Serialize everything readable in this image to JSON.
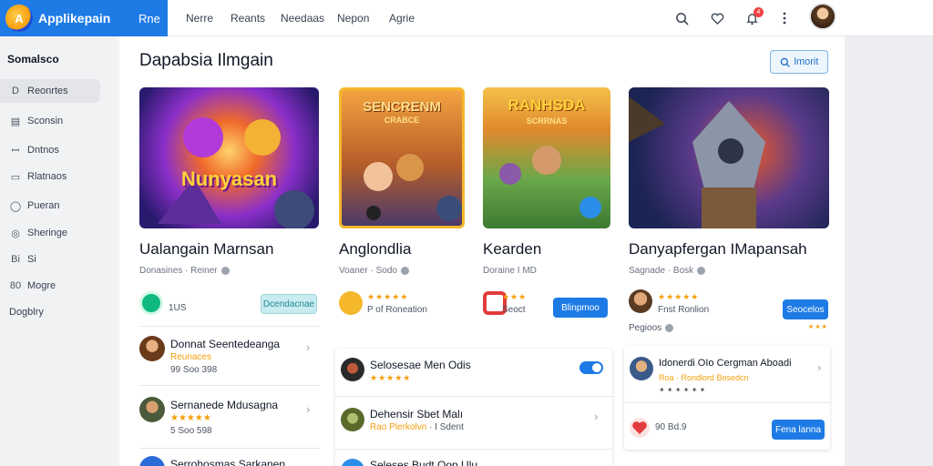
{
  "topbar": {
    "brand_name": "Applikepain",
    "brand_logo_glyph": "A",
    "nav_active": "Rne",
    "nav_items": [
      "Nerre",
      "Reants",
      "Needaas",
      "Nepon",
      "Agrie"
    ],
    "icons": [
      "search-icon",
      "heart-icon",
      "bell-icon",
      "more-icon"
    ],
    "notif_count": "4"
  },
  "sidebar": {
    "title": "Somalsco",
    "items": [
      {
        "icon": "D",
        "label": "Reonrtes"
      },
      {
        "icon": "▤",
        "label": "Sconsin"
      },
      {
        "icon": "ꟷ",
        "label": "Dntnos"
      },
      {
        "icon": "▭",
        "label": "Rlatnaos"
      },
      {
        "icon": "◯",
        "label": "Pueran"
      },
      {
        "icon": "◎",
        "label": "Sheringe"
      },
      {
        "icon": "Bi",
        "label": "Si"
      },
      {
        "icon": "80",
        "label": "Mogre"
      },
      {
        "icon": "",
        "label": "Dogblry"
      }
    ]
  },
  "main": {
    "title": "Dapabsia Ilmgain",
    "filter_label": "lmorit",
    "cards": [
      {
        "img_text": "Nunyasan",
        "title": "Ualangain Marnsan",
        "sub": "Donasines · Reiner",
        "meta": "1US",
        "button": "Dcendacnae"
      },
      {
        "img_text": "SENCRENM",
        "img_sub": "CRABCE",
        "title": "Anglondlia",
        "sub": "Voaner · Sodo",
        "meta": "P of Roneation",
        "button": ""
      },
      {
        "img_text": "RANHSDA",
        "img_sub": "SCRRNAS",
        "title": "Kearden",
        "sub": "Doraine I MD",
        "meta": "Seoct",
        "button": "Blinpmoo"
      },
      {
        "img_text": "",
        "title": "Danyapfergan IMapansah",
        "sub": "Sagnade · Bosk",
        "meta": "Fnst Ronlion",
        "extra": "Pegioos",
        "button": "Seocelos"
      }
    ],
    "list_col1": [
      {
        "title": "Donnat Seentedeanga",
        "sub": "Reunaces",
        "meta": "99 Soo 398"
      },
      {
        "title": "Sernanede Mdusagna",
        "sub": "★★★★★",
        "meta": "5 Soo 598"
      },
      {
        "title": "Serrohosmas Sarkanen",
        "sub": "",
        "meta": ""
      }
    ],
    "list_col2": [
      {
        "title": "Selosesae Men Odis",
        "sub": "★★★★★",
        "meta": ""
      },
      {
        "title": "Dehensir Sbet Malı",
        "sub": "Rao Plerkolvn",
        "meta": "· I Sdent"
      },
      {
        "title": "Seleses Budt Oop Ulu",
        "sub": "",
        "meta": ""
      }
    ],
    "list_col3": [
      {
        "title": "Idonerdi OIo Cergman Aboadi",
        "sub": "Roa · Rondlord Bosedcn",
        "meta": "✦ ✦ ✦ ✦ ✦ ✦"
      },
      {
        "title": "",
        "sub": "",
        "meta": "90 Bd.9",
        "button": "Fena lanna"
      }
    ],
    "stars": "★★★★★",
    "stars_small": "★★★"
  },
  "colors": {
    "accent": "#1e7be6",
    "star": "#f59e0b",
    "teal": "#238b94"
  }
}
